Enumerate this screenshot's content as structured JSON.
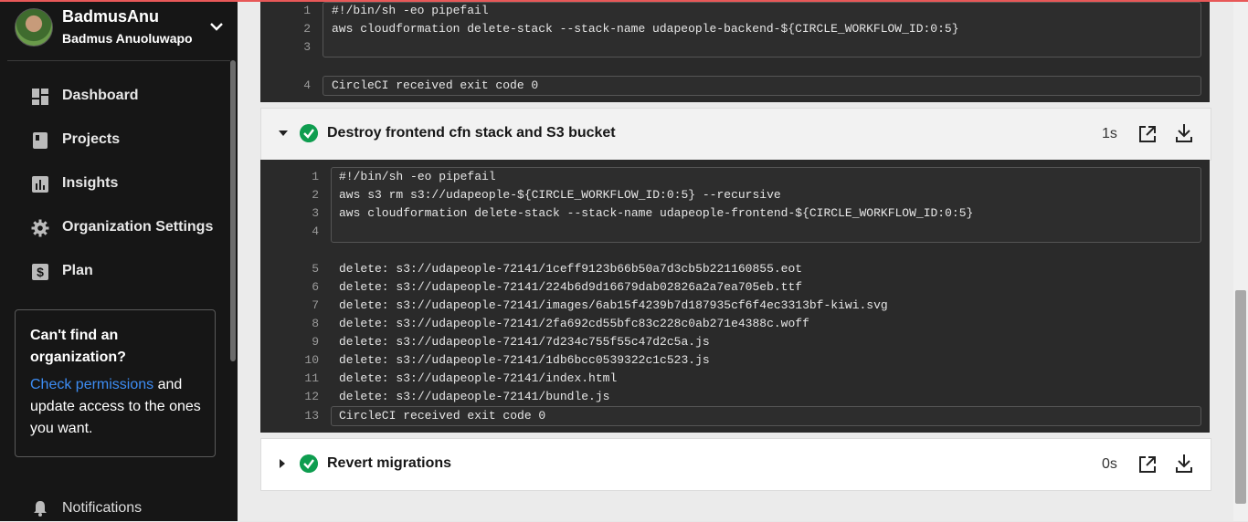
{
  "user": {
    "username": "BadmusAnu",
    "full_name": "Badmus Anuoluwapo"
  },
  "nav": {
    "items": [
      {
        "label": "Dashboard",
        "icon": "dashboard-icon"
      },
      {
        "label": "Projects",
        "icon": "projects-icon"
      },
      {
        "label": "Insights",
        "icon": "insights-icon"
      },
      {
        "label": "Organization Settings",
        "icon": "gear-icon"
      },
      {
        "label": "Plan",
        "icon": "dollar-icon"
      }
    ],
    "notifications_label": "Notifications"
  },
  "help_card": {
    "title": "Can't find an organization?",
    "link": "Check permissions",
    "body_after_link": " and update access to the ones you want."
  },
  "steps": {
    "prev": {
      "lines": [
        {
          "n": "1",
          "text": "#!/bin/sh -eo pipefail"
        },
        {
          "n": "2",
          "text": "aws cloudformation delete-stack --stack-name udapeople-backend-${CIRCLE_WORKFLOW_ID:0:5}"
        },
        {
          "n": "3",
          "text": ""
        }
      ],
      "exit": {
        "n": "4",
        "text": "CircleCI received exit code 0"
      }
    },
    "destroy_frontend": {
      "title": "Destroy frontend cfn stack and S3 bucket",
      "duration": "1s",
      "script": [
        {
          "n": "1",
          "text": "#!/bin/sh -eo pipefail"
        },
        {
          "n": "2",
          "text": "aws s3 rm s3://udapeople-${CIRCLE_WORKFLOW_ID:0:5} --recursive"
        },
        {
          "n": "3",
          "text": "aws cloudformation delete-stack --stack-name udapeople-frontend-${CIRCLE_WORKFLOW_ID:0:5}"
        },
        {
          "n": "4",
          "text": ""
        }
      ],
      "output": [
        {
          "n": "5",
          "text": "delete: s3://udapeople-72141/1ceff9123b66b50a7d3cb5b221160855.eot"
        },
        {
          "n": "6",
          "text": "delete: s3://udapeople-72141/224b6d9d16679dab02826a2a7ea705eb.ttf"
        },
        {
          "n": "7",
          "text": "delete: s3://udapeople-72141/images/6ab15f4239b7d187935cf6f4ec3313bf-kiwi.svg"
        },
        {
          "n": "8",
          "text": "delete: s3://udapeople-72141/2fa692cd55bfc83c228c0ab271e4388c.woff"
        },
        {
          "n": "9",
          "text": "delete: s3://udapeople-72141/7d234c755f55c47d2c5a.js"
        },
        {
          "n": "10",
          "text": "delete: s3://udapeople-72141/1db6bcc0539322c1c523.js"
        },
        {
          "n": "11",
          "text": "delete: s3://udapeople-72141/index.html"
        },
        {
          "n": "12",
          "text": "delete: s3://udapeople-72141/bundle.js"
        }
      ],
      "exit": {
        "n": "13",
        "text": "CircleCI received exit code 0"
      }
    },
    "revert_migrations": {
      "title": "Revert migrations",
      "duration": "0s"
    }
  },
  "colors": {
    "success": "#0e9d4f",
    "link": "#3d8df5",
    "sidebar_bg": "#161616",
    "terminal_bg": "#2a2a2a"
  }
}
